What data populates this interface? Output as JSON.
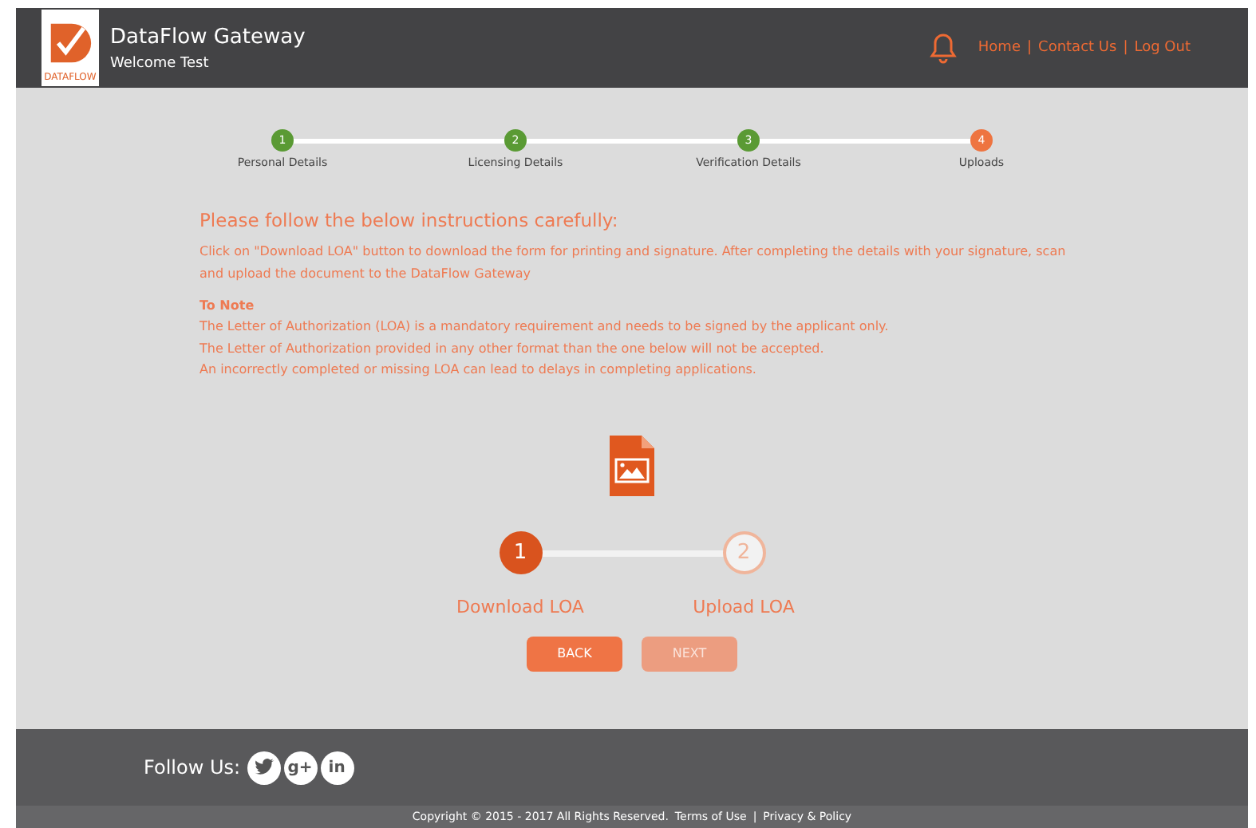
{
  "header": {
    "logo_text": "DATAFLOW",
    "title": "DataFlow Gateway",
    "welcome": "Welcome Test",
    "nav": [
      {
        "label": "Home",
        "separator": "|"
      },
      {
        "label": "Contact Us",
        "separator": "|"
      },
      {
        "label": "Log Out"
      }
    ]
  },
  "steps": [
    {
      "number": "1",
      "label": "Personal Details",
      "completed": true
    },
    {
      "number": "2",
      "label": "Licensing Details",
      "completed": true
    },
    {
      "number": "3",
      "label": "Verification Details",
      "completed": true
    },
    {
      "number": "4",
      "label": "Uploads",
      "completed": false
    }
  ],
  "instructions": {
    "heading": "Please follow the below instructions carefully:",
    "body": "Click on \"Download LOA\" button to download the form for printing and signature. After completing the details with your signature, scan and upload the document to the DataFlow Gateway",
    "note_title": "To Note",
    "notes": [
      "The Letter of Authorization (LOA) is a mandatory requirement and needs to be signed by the applicant only.",
      "The Letter of Authorization provided in any other format than the one below will not be accepted.",
      "An incorrectly completed or missing LOA can lead to delays in completing applications."
    ]
  },
  "substeps": [
    {
      "number": "1",
      "label": "Download LOA",
      "selected": true
    },
    {
      "number": "2",
      "label": "Upload LOA",
      "selected": false
    }
  ],
  "buttons": [
    {
      "label": "BACK",
      "disabled": false
    },
    {
      "label": "NEXT",
      "disabled": true
    }
  ],
  "footer": {
    "follow": "Follow Us:",
    "social": [
      {
        "kind": "twitter"
      },
      {
        "kind": "text",
        "glyph": "g+"
      },
      {
        "kind": "text",
        "glyph": "in"
      }
    ],
    "copyright": "Copyright © 2015 - 2017 All Rights Reserved.",
    "links": [
      {
        "label": "Terms of Use",
        "separator": "|"
      },
      {
        "label": "Privacy & Policy"
      }
    ]
  }
}
